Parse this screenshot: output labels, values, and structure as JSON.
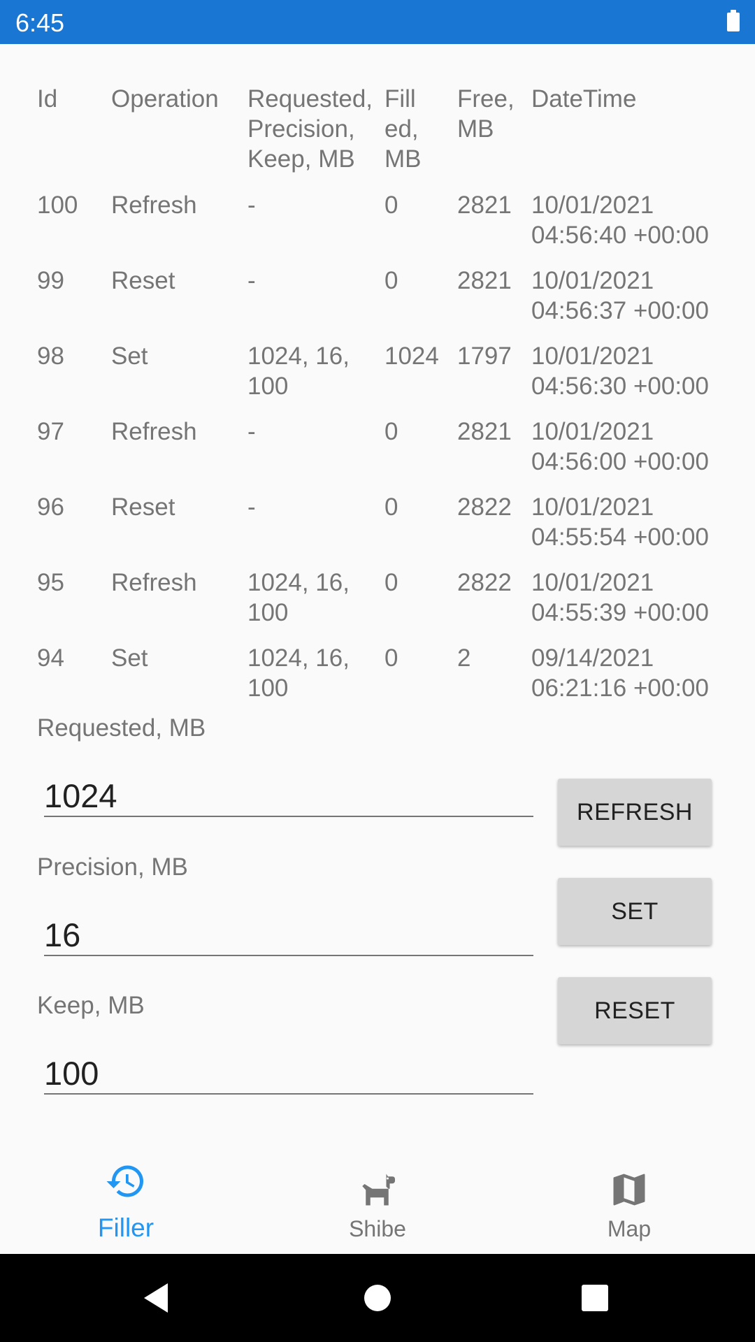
{
  "status_bar": {
    "time": "6:45",
    "battery_icon": "battery-full-icon"
  },
  "table": {
    "headers": {
      "id": "Id",
      "operation": "Operation",
      "requested": "Requested,\nPrecision,\nKeep, MB",
      "filled": "Fill\ned,\nMB",
      "free": "Free,\nMB",
      "datetime": "DateTime"
    },
    "rows": [
      {
        "id": "100",
        "operation": "Refresh",
        "requested": "-",
        "filled": "0",
        "free": "2821",
        "datetime": "10/01/2021\n04:56:40 +00:00"
      },
      {
        "id": "99",
        "operation": "Reset",
        "requested": "-",
        "filled": "0",
        "free": "2821",
        "datetime": "10/01/2021\n04:56:37 +00:00"
      },
      {
        "id": "98",
        "operation": "Set",
        "requested": "1024, 16,\n100",
        "filled": "1024",
        "free": "1797",
        "datetime": "10/01/2021\n04:56:30 +00:00"
      },
      {
        "id": "97",
        "operation": "Refresh",
        "requested": "-",
        "filled": "0",
        "free": "2821",
        "datetime": "10/01/2021\n04:56:00 +00:00"
      },
      {
        "id": "96",
        "operation": "Reset",
        "requested": "-",
        "filled": "0",
        "free": "2822",
        "datetime": "10/01/2021\n04:55:54 +00:00"
      },
      {
        "id": "95",
        "operation": "Refresh",
        "requested": "1024, 16,\n100",
        "filled": "0",
        "free": "2822",
        "datetime": "10/01/2021\n04:55:39 +00:00"
      },
      {
        "id": "94",
        "operation": "Set",
        "requested": "1024, 16,\n100",
        "filled": "0",
        "free": "2",
        "datetime": "09/14/2021\n06:21:16 +00:00"
      }
    ]
  },
  "form": {
    "requested": {
      "label": "Requested, MB",
      "value": "1024"
    },
    "precision": {
      "label": "Precision, MB",
      "value": "16"
    },
    "keep": {
      "label": "Keep, MB",
      "value": "100"
    }
  },
  "buttons": {
    "refresh": "REFRESH",
    "set": "SET",
    "reset": "RESET"
  },
  "bottom_nav": {
    "active_color": "#2196f3",
    "items": [
      {
        "label": "Filler",
        "icon": "history-icon"
      },
      {
        "label": "Shibe",
        "icon": "dog-icon"
      },
      {
        "label": "Map",
        "icon": "map-icon"
      }
    ]
  },
  "colors": {
    "status_bar": "#1976d2",
    "text_secondary": "#757575",
    "button_bg": "#d6d6d6"
  }
}
